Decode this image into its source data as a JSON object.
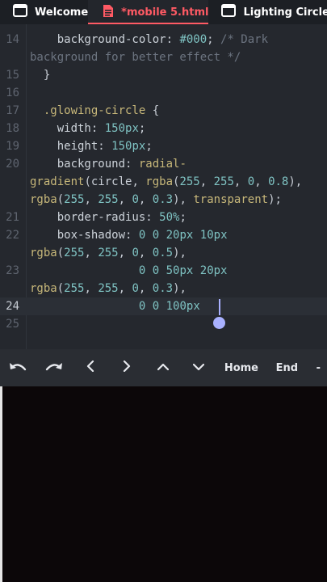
{
  "tabs": [
    {
      "label": "Welcome",
      "icon": "window-icon",
      "active": false
    },
    {
      "label": "*mobile 5.html",
      "icon": "file-icon",
      "active": true
    },
    {
      "label": "Lighting Circle",
      "icon": "window-icon",
      "active": false
    }
  ],
  "editor": {
    "lines": [
      {
        "num": "14",
        "segments": [
          [
            "p",
            "    "
          ],
          [
            "prop",
            "background-color"
          ],
          [
            "p",
            ": "
          ],
          [
            "num",
            "#000"
          ],
          [
            "p",
            "; "
          ],
          [
            "cm",
            "/* Dark"
          ]
        ]
      },
      {
        "num": "",
        "segments": [
          [
            "cm",
            "background for better effect */"
          ]
        ]
      },
      {
        "num": "15",
        "segments": [
          [
            "p",
            "  }"
          ]
        ]
      },
      {
        "num": "16",
        "segments": []
      },
      {
        "num": "17",
        "segments": [
          [
            "p",
            "  "
          ],
          [
            "sel",
            ".glowing-circle"
          ],
          [
            "p",
            " {"
          ]
        ]
      },
      {
        "num": "18",
        "segments": [
          [
            "p",
            "    "
          ],
          [
            "prop",
            "width"
          ],
          [
            "p",
            ": "
          ],
          [
            "num",
            "150px"
          ],
          [
            "p",
            ";"
          ]
        ]
      },
      {
        "num": "19",
        "segments": [
          [
            "p",
            "    "
          ],
          [
            "prop",
            "height"
          ],
          [
            "p",
            ": "
          ],
          [
            "num",
            "150px"
          ],
          [
            "p",
            ";"
          ]
        ]
      },
      {
        "num": "20",
        "segments": [
          [
            "p",
            "    "
          ],
          [
            "prop",
            "background"
          ],
          [
            "p",
            ": "
          ],
          [
            "fn",
            "radial-"
          ]
        ]
      },
      {
        "num": "",
        "segments": [
          [
            "fn",
            "gradient"
          ],
          [
            "p",
            "(circle, "
          ],
          [
            "fn",
            "rgba"
          ],
          [
            "p",
            "("
          ],
          [
            "num",
            "255"
          ],
          [
            "p",
            ", "
          ],
          [
            "num",
            "255"
          ],
          [
            "p",
            ", "
          ],
          [
            "num",
            "0"
          ],
          [
            "p",
            ", "
          ],
          [
            "num",
            "0.8"
          ],
          [
            "p",
            "),"
          ]
        ]
      },
      {
        "num": "",
        "segments": [
          [
            "fn",
            "rgba"
          ],
          [
            "p",
            "("
          ],
          [
            "num",
            "255"
          ],
          [
            "p",
            ", "
          ],
          [
            "num",
            "255"
          ],
          [
            "p",
            ", "
          ],
          [
            "num",
            "0"
          ],
          [
            "p",
            ", "
          ],
          [
            "num",
            "0.3"
          ],
          [
            "p",
            "), "
          ],
          [
            "kw",
            "transparent"
          ],
          [
            "p",
            ");"
          ]
        ]
      },
      {
        "num": "21",
        "segments": [
          [
            "p",
            "    "
          ],
          [
            "prop",
            "border-radius"
          ],
          [
            "p",
            ": "
          ],
          [
            "num",
            "50%"
          ],
          [
            "p",
            ";"
          ]
        ]
      },
      {
        "num": "22",
        "segments": [
          [
            "p",
            "    "
          ],
          [
            "prop",
            "box-shadow"
          ],
          [
            "p",
            ": "
          ],
          [
            "num",
            "0"
          ],
          [
            "p",
            " "
          ],
          [
            "num",
            "0"
          ],
          [
            "p",
            " "
          ],
          [
            "num",
            "20px"
          ],
          [
            "p",
            " "
          ],
          [
            "num",
            "10px"
          ]
        ]
      },
      {
        "num": "",
        "segments": [
          [
            "fn",
            "rgba"
          ],
          [
            "p",
            "("
          ],
          [
            "num",
            "255"
          ],
          [
            "p",
            ", "
          ],
          [
            "num",
            "255"
          ],
          [
            "p",
            ", "
          ],
          [
            "num",
            "0"
          ],
          [
            "p",
            ", "
          ],
          [
            "num",
            "0.5"
          ],
          [
            "p",
            "),"
          ]
        ]
      },
      {
        "num": "23",
        "segments": [
          [
            "p",
            "                "
          ],
          [
            "num",
            "0"
          ],
          [
            "p",
            " "
          ],
          [
            "num",
            "0"
          ],
          [
            "p",
            " "
          ],
          [
            "num",
            "50px"
          ],
          [
            "p",
            " "
          ],
          [
            "num",
            "20px"
          ]
        ]
      },
      {
        "num": "",
        "segments": [
          [
            "fn",
            "rgba"
          ],
          [
            "p",
            "("
          ],
          [
            "num",
            "255"
          ],
          [
            "p",
            ", "
          ],
          [
            "num",
            "255"
          ],
          [
            "p",
            ", "
          ],
          [
            "num",
            "0"
          ],
          [
            "p",
            ", "
          ],
          [
            "num",
            "0.3"
          ],
          [
            "p",
            "),"
          ]
        ]
      },
      {
        "num": "24",
        "segments": [
          [
            "p",
            "                "
          ],
          [
            "num",
            "0"
          ],
          [
            "p",
            " "
          ],
          [
            "num",
            "0"
          ],
          [
            "p",
            " "
          ],
          [
            "num",
            "100px"
          ]
        ]
      },
      {
        "num": "25",
        "segments": []
      }
    ],
    "current_line": "24"
  },
  "keybar": {
    "undo_icon": "undo-icon",
    "redo_icon": "redo-icon",
    "left_icon": "chevron-left-icon",
    "right_icon": "chevron-right-icon",
    "up_icon": "chevron-up-icon",
    "down_icon": "chevron-down-icon",
    "home_label": "Home",
    "end_label": "End",
    "dash_label": "-"
  },
  "colors": {
    "active_tab": "#ff5a64",
    "editor_bg": "#25282e",
    "caret": "#a9b1ff",
    "preview_bg": "#0c0709"
  }
}
